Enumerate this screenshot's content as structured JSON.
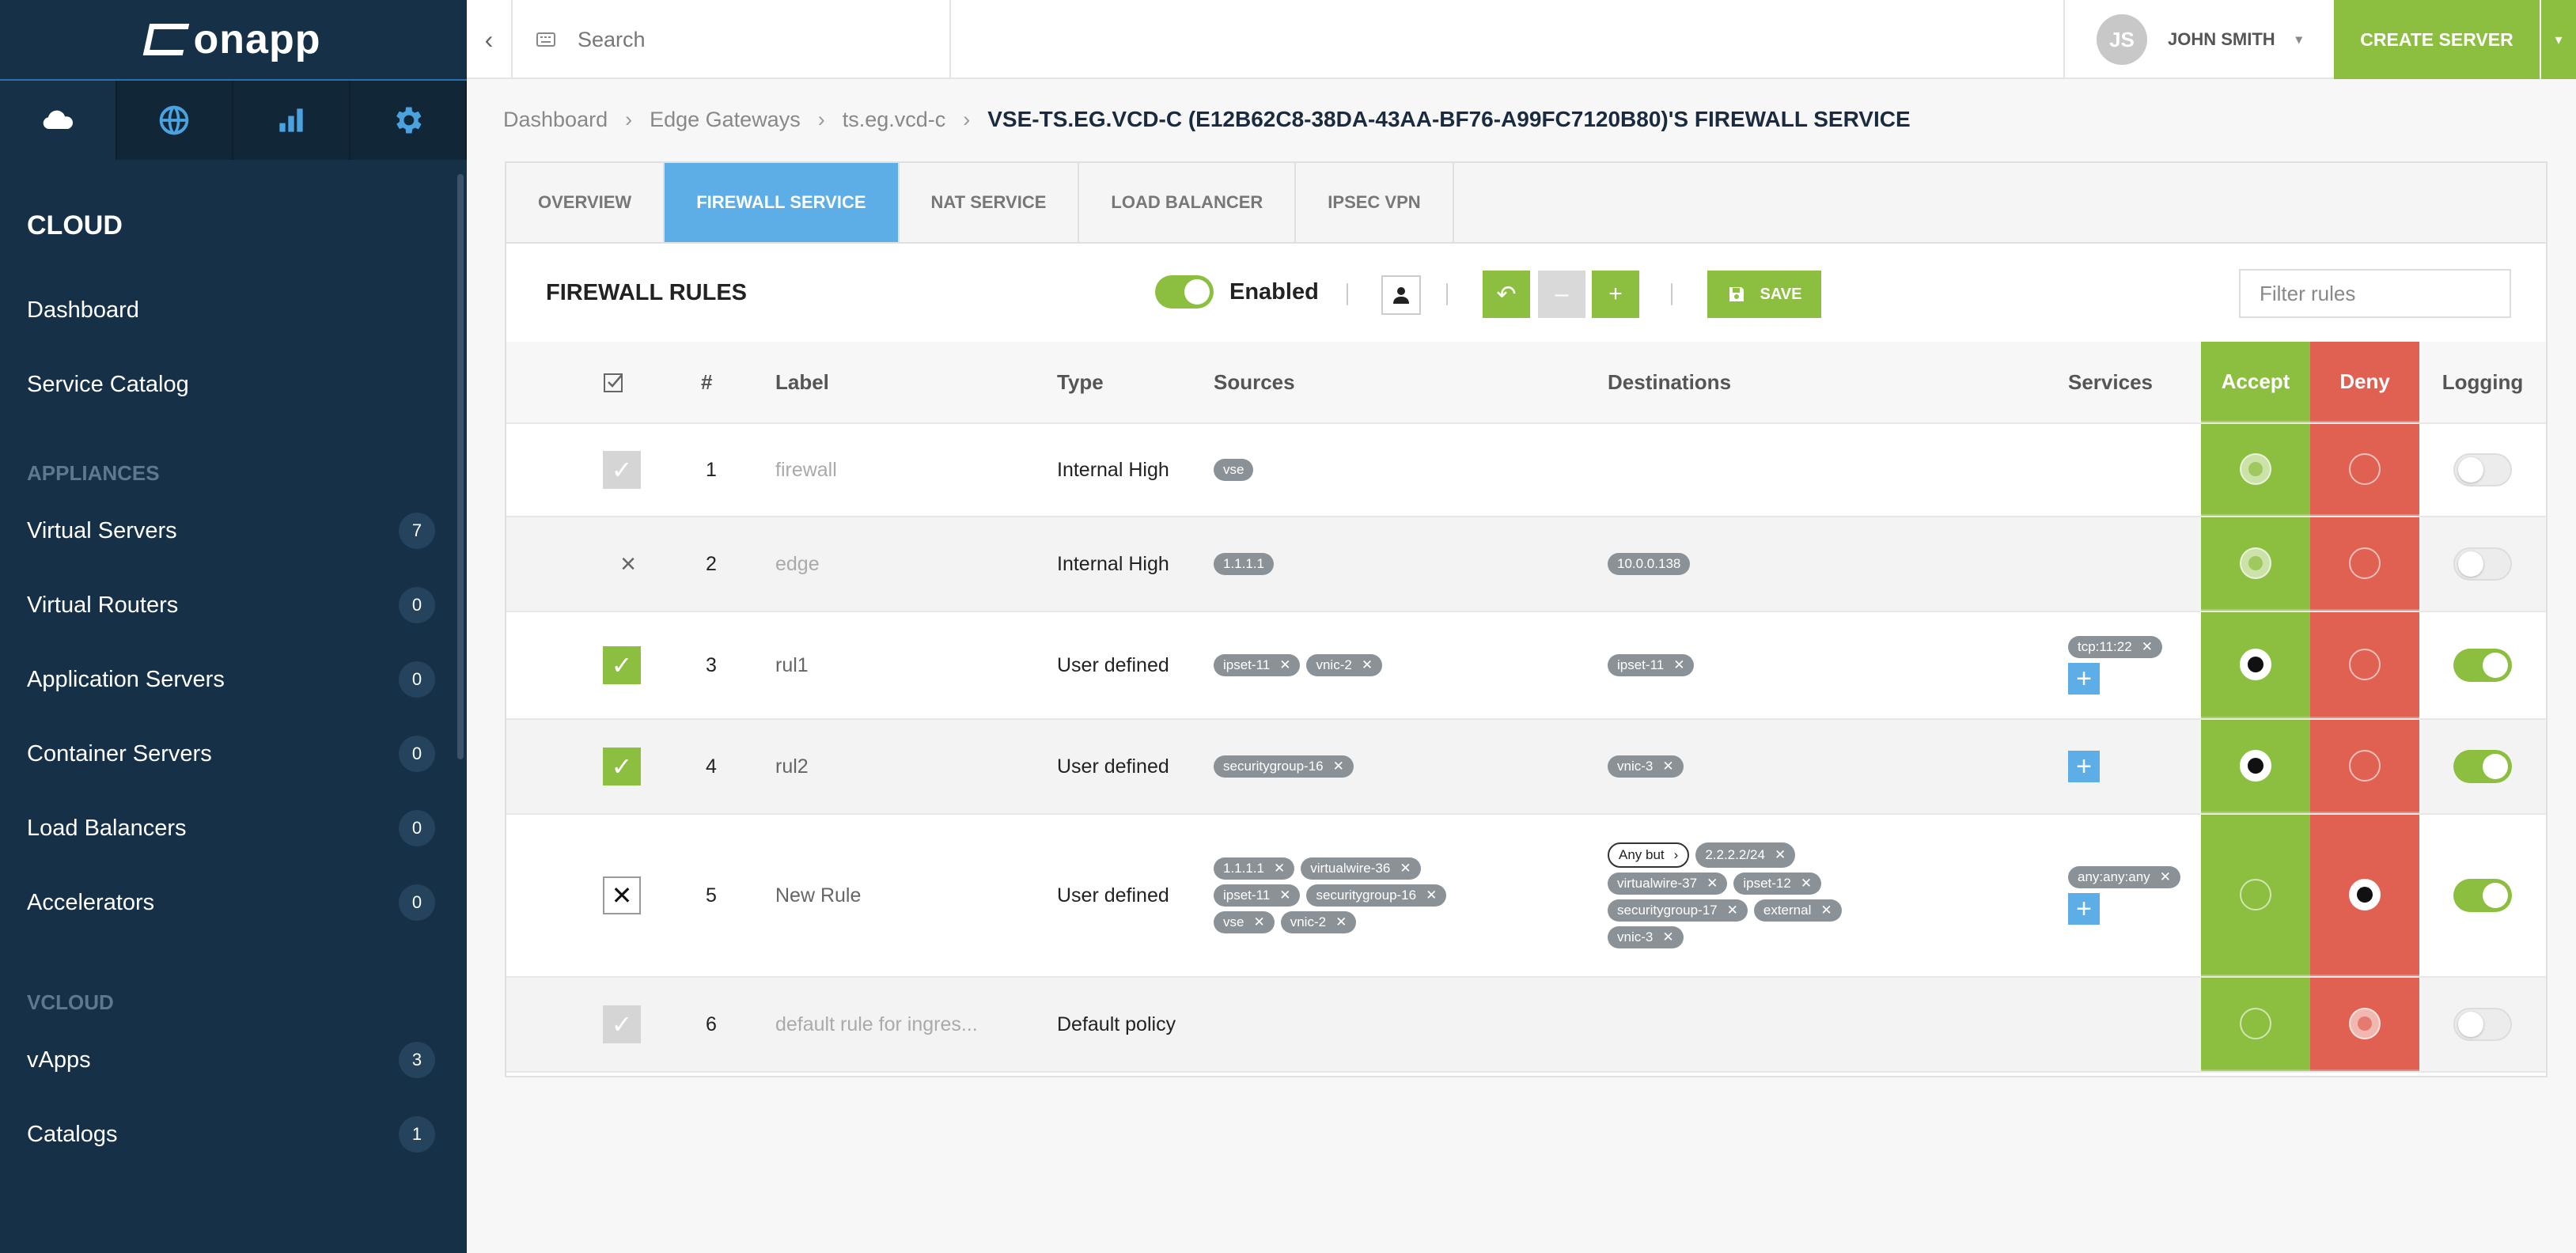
{
  "sidebar": {
    "logo": "onapp",
    "section_title": "CLOUD",
    "top_items": [
      {
        "label": "Dashboard"
      },
      {
        "label": "Service Catalog"
      }
    ],
    "appliances_header": "APPLIANCES",
    "appliances": [
      {
        "label": "Virtual Servers",
        "count": "7"
      },
      {
        "label": "Virtual Routers",
        "count": "0"
      },
      {
        "label": "Application Servers",
        "count": "0"
      },
      {
        "label": "Container Servers",
        "count": "0"
      },
      {
        "label": "Load Balancers",
        "count": "0"
      },
      {
        "label": "Accelerators",
        "count": "0"
      }
    ],
    "vcloud_header": "VCLOUD",
    "vcloud": [
      {
        "label": "vApps",
        "count": "3"
      },
      {
        "label": "Catalogs",
        "count": "1"
      }
    ],
    "icons": [
      "cloud-icon",
      "globe-icon",
      "bar-chart-icon",
      "gear-icon"
    ]
  },
  "topbar": {
    "search_placeholder": "Search",
    "user_initials": "JS",
    "user_name": "JOHN SMITH",
    "create_label": "CREATE SERVER"
  },
  "breadcrumb": {
    "items": [
      "Dashboard",
      "Edge Gateways",
      "ts.eg.vcd-c"
    ],
    "current": "VSE-TS.EG.VCD-C (E12B62C8-38DA-43AA-BF76-A99FC7120B80)'S FIREWALL SERVICE"
  },
  "tabs": [
    "OVERVIEW",
    "FIREWALL SERVICE",
    "NAT SERVICE",
    "LOAD BALANCER",
    "IPSEC VPN"
  ],
  "toolbar": {
    "title": "FIREWALL RULES",
    "enabled_label": "Enabled",
    "save_label": "SAVE",
    "filter_placeholder": "Filter rules"
  },
  "table": {
    "headers": {
      "num": "#",
      "label": "Label",
      "type": "Type",
      "sources": "Sources",
      "destinations": "Destinations",
      "services": "Services",
      "accept": "Accept",
      "deny": "Deny",
      "logging": "Logging"
    },
    "rows": [
      {
        "num": "1",
        "label": "firewall",
        "type": "Internal High"
      },
      {
        "num": "2",
        "label": "edge",
        "type": "Internal High"
      },
      {
        "num": "3",
        "label": "rul1",
        "type": "User defined"
      },
      {
        "num": "4",
        "label": "rul2",
        "type": "User defined"
      },
      {
        "num": "5",
        "label": "New Rule",
        "type": "User defined"
      },
      {
        "num": "6",
        "label": "default rule for ingres...",
        "type": "Default policy"
      }
    ],
    "tags": {
      "r1_src": [
        "vse"
      ],
      "r2_src": [
        "1.1.1.1"
      ],
      "r2_dst": [
        "10.0.0.138"
      ],
      "r3_src": [
        "ipset-11",
        "vnic-2"
      ],
      "r3_dst": [
        "ipset-11"
      ],
      "r3_svc": [
        "tcp:11:22"
      ],
      "r4_src": [
        "securitygroup-16"
      ],
      "r4_dst": [
        "vnic-3"
      ],
      "r5_src": [
        "1.1.1.1",
        "virtualwire-36",
        "ipset-11",
        "securitygroup-16",
        "vse",
        "vnic-2"
      ],
      "r5_any_but": "Any but",
      "r5_dst": [
        "2.2.2.2/24",
        "virtualwire-37",
        "ipset-12",
        "securitygroup-17",
        "external",
        "vnic-3"
      ],
      "r5_svc": [
        "any:any:any"
      ]
    }
  },
  "colors": {
    "sidebar_bg": "#153047",
    "accent_green": "#8cbf3f",
    "deny_red": "#e06052",
    "tab_active": "#5dade6"
  }
}
